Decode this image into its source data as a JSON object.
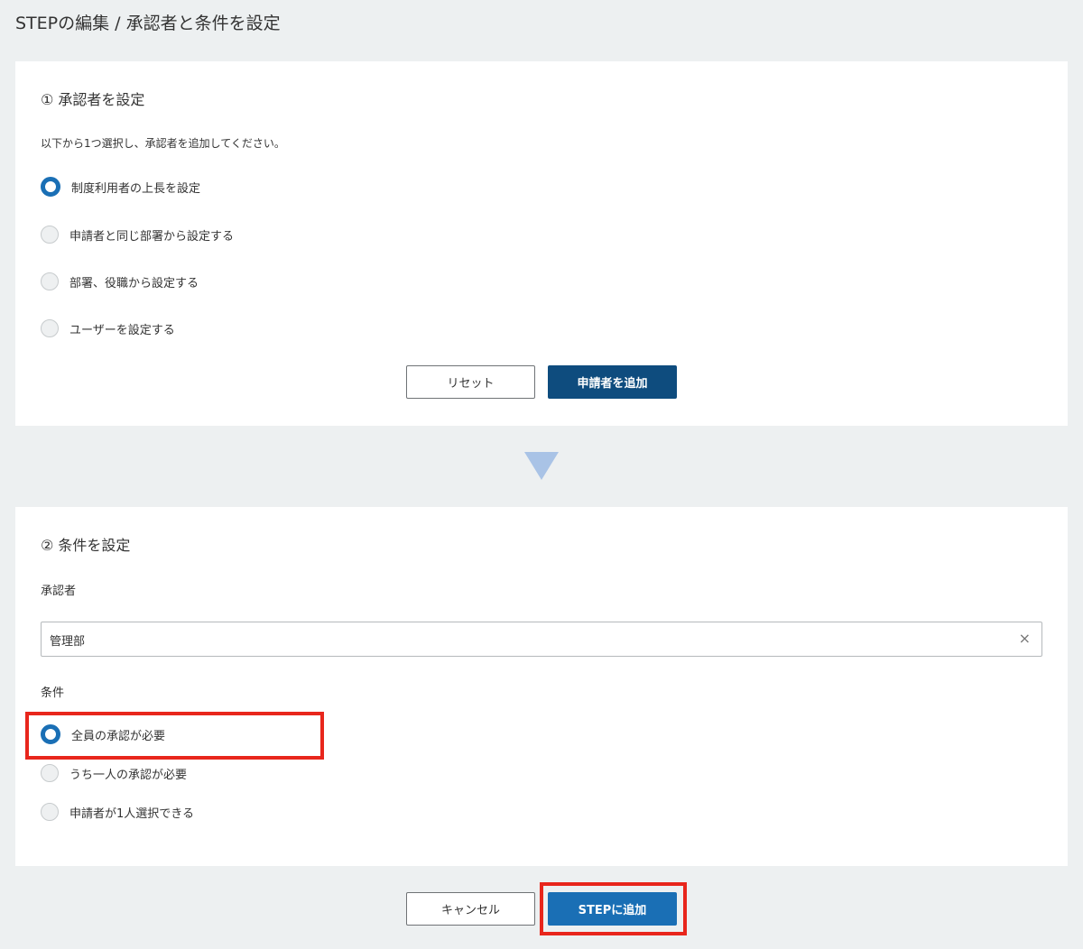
{
  "page": {
    "title": "STEPの編集 / 承認者と条件を設定"
  },
  "approver_section": {
    "title": "① 承認者を設定",
    "description": "以下から1つ選択し、承認者を追加してください。",
    "options": [
      {
        "label": "制度利用者の上長を設定",
        "checked": true
      },
      {
        "label": "申請者と同じ部署から設定する",
        "checked": false
      },
      {
        "label": "部署、役職から設定する",
        "checked": false
      },
      {
        "label": "ユーザーを設定する",
        "checked": false
      }
    ],
    "reset_label": "リセット",
    "add_label": "申請者を追加"
  },
  "condition_section": {
    "title": "② 条件を設定",
    "approver_label": "承認者",
    "approver_value": "管理部",
    "clear_symbol": "×",
    "condition_label": "条件",
    "options": [
      {
        "label": "全員の承認が必要",
        "checked": true
      },
      {
        "label": "うち一人の承認が必要",
        "checked": false
      },
      {
        "label": "申請者が1人選択できる",
        "checked": false
      }
    ]
  },
  "footer": {
    "cancel_label": "キャンセル",
    "submit_label": "STEPに追加"
  },
  "colors": {
    "primary": "#1a6fb5",
    "primary_dark": "#0e4c7e",
    "highlight": "#e8261c",
    "arrow": "#a9c3e6"
  }
}
